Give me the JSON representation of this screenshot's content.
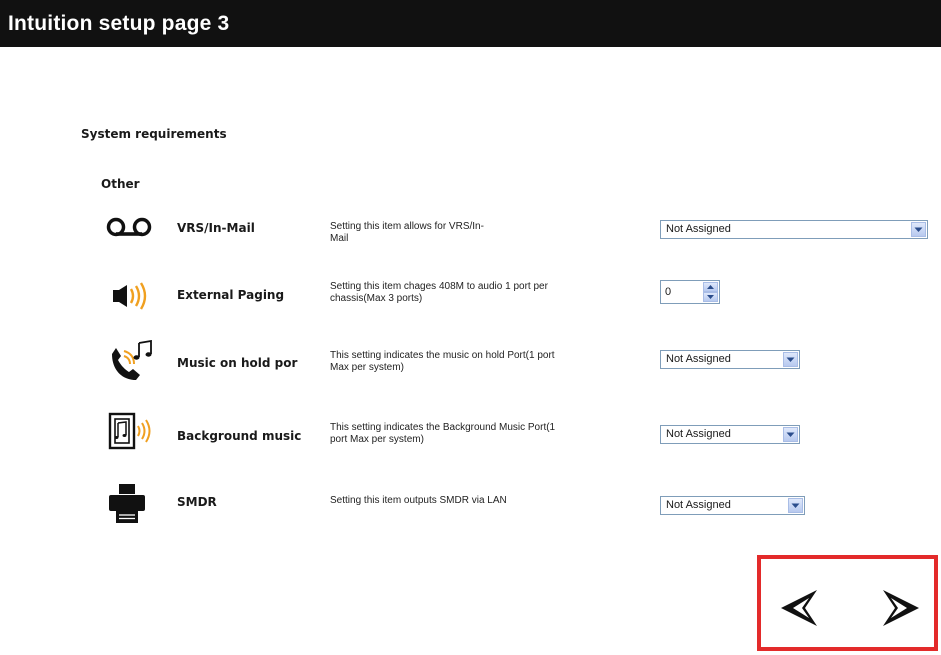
{
  "header": {
    "title": "Intuition setup page 3"
  },
  "section_title": "System requirements",
  "group_title": "Other",
  "rows": [
    {
      "icon": "voicemail-icon",
      "label": "VRS/In-Mail",
      "description": "Setting this item allows for VRS/In-Mail",
      "control": "select",
      "value": "Not Assigned"
    },
    {
      "icon": "speaker-paging-icon",
      "label": "External Paging",
      "description": "Setting this item chages 408M to audio 1 port per chassis(Max 3 ports)",
      "control": "stepper",
      "value": "0"
    },
    {
      "icon": "phone-music-icon",
      "label": "Music on hold por",
      "description": "This setting indicates the music on hold Port(1 port Max per system)",
      "control": "select",
      "value": "Not Assigned"
    },
    {
      "icon": "background-music-icon",
      "label": "Background music",
      "description": "This setting indicates the Background Music Port(1 port Max per system)",
      "control": "select",
      "value": "Not Assigned"
    },
    {
      "icon": "printer-icon",
      "label": "SMDR",
      "description": "Setting this item outputs SMDR via LAN",
      "control": "select",
      "value": "Not Assigned"
    }
  ],
  "navigation": {
    "prev_icon": "previous-arrow-icon",
    "next_icon": "next-arrow-icon",
    "highlight_color": "#e32a2a"
  },
  "colors": {
    "titlebar": "#111111",
    "title_text": "#ffffff"
  }
}
